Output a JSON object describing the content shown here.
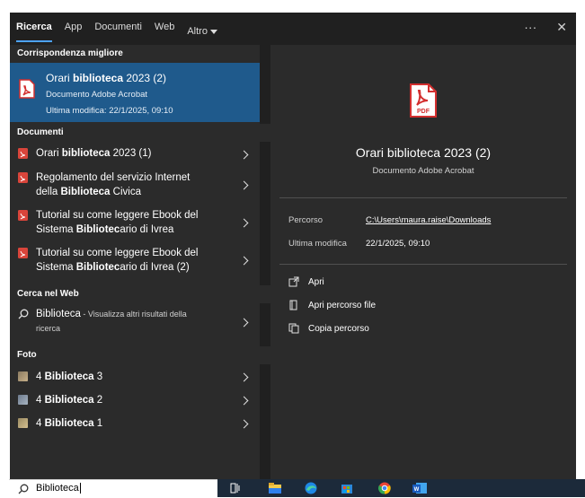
{
  "tabs": [
    {
      "label": "Ricerca",
      "active": true
    },
    {
      "label": "App",
      "active": false
    },
    {
      "label": "Documenti",
      "active": false
    },
    {
      "label": "Web",
      "active": false
    },
    {
      "label": "Altro",
      "active": false
    }
  ],
  "top_icons": {
    "more": "···",
    "close": "✕"
  },
  "sections": {
    "best": "Corrispondenza migliore",
    "docs": "Documenti",
    "web": "Cerca nel Web",
    "photos": "Foto"
  },
  "best_match": {
    "title_pre": "Orari ",
    "title_bold": "biblioteca",
    "title_post": " 2023 (2)",
    "type": "Documento Adobe Acrobat",
    "modified": "Ultima modifica: 22/1/2025, 09:10"
  },
  "documents": [
    {
      "pre": "Orari ",
      "bold": "biblioteca",
      "post": " 2023 (1)"
    },
    {
      "line1": "Regolamento del servizio Internet",
      "pre2": "della ",
      "bold": "Biblioteca",
      "post2": " Civica"
    },
    {
      "line1": "Tutorial su come leggere Ebook del",
      "pre2": "Sistema ",
      "bold": "Bibliotec",
      "post2": "ario di Ivrea"
    },
    {
      "line1": "Tutorial su come leggere Ebook del",
      "pre2": "Sistema ",
      "bold": "Bibliotec",
      "post2": "ario di Ivrea (2)"
    }
  ],
  "web_result": {
    "term": "Biblioteca",
    "rest": " - Visualizza altri risultati della",
    "rest2": "ricerca"
  },
  "photos": [
    {
      "pre": "4 ",
      "bold": "Biblioteca",
      "post": " 3"
    },
    {
      "pre": "4 ",
      "bold": "Biblioteca",
      "post": " 2"
    },
    {
      "pre": "4 ",
      "bold": "Biblioteca",
      "post": " 1"
    }
  ],
  "preview": {
    "title": "Orari biblioteca 2023 (2)",
    "type": "Documento Adobe Acrobat",
    "path_label": "Percorso",
    "path_value": "C:\\Users\\maura.raise\\Downloads",
    "modified_label": "Ultima modifica",
    "modified_value": "22/1/2025, 09:10",
    "pdf_badge": "PDF",
    "actions": [
      "Apri",
      "Apri percorso file",
      "Copia percorso"
    ]
  },
  "search": {
    "value": "Biblioteca"
  },
  "colors": {
    "selected": "#1f5a8c",
    "accent": "#4da3ff",
    "pdf_red": "#d32f2f"
  }
}
